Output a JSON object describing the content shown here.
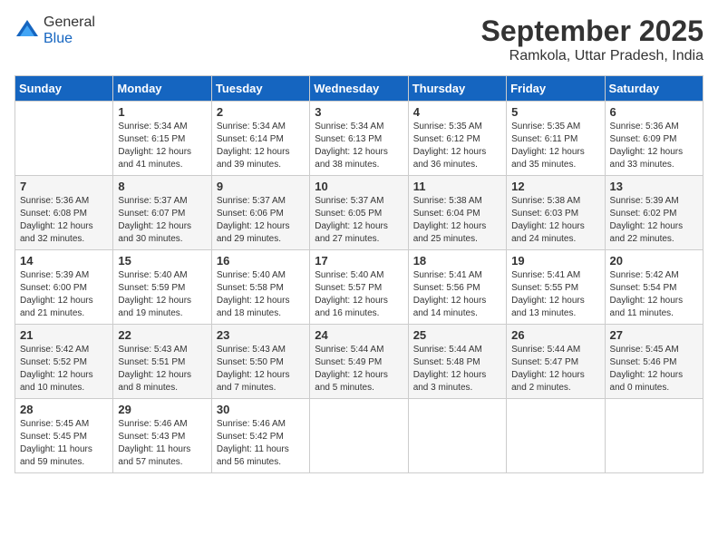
{
  "header": {
    "logo_general": "General",
    "logo_blue": "Blue",
    "month_title": "September 2025",
    "location": "Ramkola, Uttar Pradesh, India"
  },
  "weekdays": [
    "Sunday",
    "Monday",
    "Tuesday",
    "Wednesday",
    "Thursday",
    "Friday",
    "Saturday"
  ],
  "weeks": [
    [
      {
        "day": "",
        "sunrise": "",
        "sunset": "",
        "daylight": ""
      },
      {
        "day": "1",
        "sunrise": "Sunrise: 5:34 AM",
        "sunset": "Sunset: 6:15 PM",
        "daylight": "Daylight: 12 hours and 41 minutes."
      },
      {
        "day": "2",
        "sunrise": "Sunrise: 5:34 AM",
        "sunset": "Sunset: 6:14 PM",
        "daylight": "Daylight: 12 hours and 39 minutes."
      },
      {
        "day": "3",
        "sunrise": "Sunrise: 5:34 AM",
        "sunset": "Sunset: 6:13 PM",
        "daylight": "Daylight: 12 hours and 38 minutes."
      },
      {
        "day": "4",
        "sunrise": "Sunrise: 5:35 AM",
        "sunset": "Sunset: 6:12 PM",
        "daylight": "Daylight: 12 hours and 36 minutes."
      },
      {
        "day": "5",
        "sunrise": "Sunrise: 5:35 AM",
        "sunset": "Sunset: 6:11 PM",
        "daylight": "Daylight: 12 hours and 35 minutes."
      },
      {
        "day": "6",
        "sunrise": "Sunrise: 5:36 AM",
        "sunset": "Sunset: 6:09 PM",
        "daylight": "Daylight: 12 hours and 33 minutes."
      }
    ],
    [
      {
        "day": "7",
        "sunrise": "Sunrise: 5:36 AM",
        "sunset": "Sunset: 6:08 PM",
        "daylight": "Daylight: 12 hours and 32 minutes."
      },
      {
        "day": "8",
        "sunrise": "Sunrise: 5:37 AM",
        "sunset": "Sunset: 6:07 PM",
        "daylight": "Daylight: 12 hours and 30 minutes."
      },
      {
        "day": "9",
        "sunrise": "Sunrise: 5:37 AM",
        "sunset": "Sunset: 6:06 PM",
        "daylight": "Daylight: 12 hours and 29 minutes."
      },
      {
        "day": "10",
        "sunrise": "Sunrise: 5:37 AM",
        "sunset": "Sunset: 6:05 PM",
        "daylight": "Daylight: 12 hours and 27 minutes."
      },
      {
        "day": "11",
        "sunrise": "Sunrise: 5:38 AM",
        "sunset": "Sunset: 6:04 PM",
        "daylight": "Daylight: 12 hours and 25 minutes."
      },
      {
        "day": "12",
        "sunrise": "Sunrise: 5:38 AM",
        "sunset": "Sunset: 6:03 PM",
        "daylight": "Daylight: 12 hours and 24 minutes."
      },
      {
        "day": "13",
        "sunrise": "Sunrise: 5:39 AM",
        "sunset": "Sunset: 6:02 PM",
        "daylight": "Daylight: 12 hours and 22 minutes."
      }
    ],
    [
      {
        "day": "14",
        "sunrise": "Sunrise: 5:39 AM",
        "sunset": "Sunset: 6:00 PM",
        "daylight": "Daylight: 12 hours and 21 minutes."
      },
      {
        "day": "15",
        "sunrise": "Sunrise: 5:40 AM",
        "sunset": "Sunset: 5:59 PM",
        "daylight": "Daylight: 12 hours and 19 minutes."
      },
      {
        "day": "16",
        "sunrise": "Sunrise: 5:40 AM",
        "sunset": "Sunset: 5:58 PM",
        "daylight": "Daylight: 12 hours and 18 minutes."
      },
      {
        "day": "17",
        "sunrise": "Sunrise: 5:40 AM",
        "sunset": "Sunset: 5:57 PM",
        "daylight": "Daylight: 12 hours and 16 minutes."
      },
      {
        "day": "18",
        "sunrise": "Sunrise: 5:41 AM",
        "sunset": "Sunset: 5:56 PM",
        "daylight": "Daylight: 12 hours and 14 minutes."
      },
      {
        "day": "19",
        "sunrise": "Sunrise: 5:41 AM",
        "sunset": "Sunset: 5:55 PM",
        "daylight": "Daylight: 12 hours and 13 minutes."
      },
      {
        "day": "20",
        "sunrise": "Sunrise: 5:42 AM",
        "sunset": "Sunset: 5:54 PM",
        "daylight": "Daylight: 12 hours and 11 minutes."
      }
    ],
    [
      {
        "day": "21",
        "sunrise": "Sunrise: 5:42 AM",
        "sunset": "Sunset: 5:52 PM",
        "daylight": "Daylight: 12 hours and 10 minutes."
      },
      {
        "day": "22",
        "sunrise": "Sunrise: 5:43 AM",
        "sunset": "Sunset: 5:51 PM",
        "daylight": "Daylight: 12 hours and 8 minutes."
      },
      {
        "day": "23",
        "sunrise": "Sunrise: 5:43 AM",
        "sunset": "Sunset: 5:50 PM",
        "daylight": "Daylight: 12 hours and 7 minutes."
      },
      {
        "day": "24",
        "sunrise": "Sunrise: 5:44 AM",
        "sunset": "Sunset: 5:49 PM",
        "daylight": "Daylight: 12 hours and 5 minutes."
      },
      {
        "day": "25",
        "sunrise": "Sunrise: 5:44 AM",
        "sunset": "Sunset: 5:48 PM",
        "daylight": "Daylight: 12 hours and 3 minutes."
      },
      {
        "day": "26",
        "sunrise": "Sunrise: 5:44 AM",
        "sunset": "Sunset: 5:47 PM",
        "daylight": "Daylight: 12 hours and 2 minutes."
      },
      {
        "day": "27",
        "sunrise": "Sunrise: 5:45 AM",
        "sunset": "Sunset: 5:46 PM",
        "daylight": "Daylight: 12 hours and 0 minutes."
      }
    ],
    [
      {
        "day": "28",
        "sunrise": "Sunrise: 5:45 AM",
        "sunset": "Sunset: 5:45 PM",
        "daylight": "Daylight: 11 hours and 59 minutes."
      },
      {
        "day": "29",
        "sunrise": "Sunrise: 5:46 AM",
        "sunset": "Sunset: 5:43 PM",
        "daylight": "Daylight: 11 hours and 57 minutes."
      },
      {
        "day": "30",
        "sunrise": "Sunrise: 5:46 AM",
        "sunset": "Sunset: 5:42 PM",
        "daylight": "Daylight: 11 hours and 56 minutes."
      },
      {
        "day": "",
        "sunrise": "",
        "sunset": "",
        "daylight": ""
      },
      {
        "day": "",
        "sunrise": "",
        "sunset": "",
        "daylight": ""
      },
      {
        "day": "",
        "sunrise": "",
        "sunset": "",
        "daylight": ""
      },
      {
        "day": "",
        "sunrise": "",
        "sunset": "",
        "daylight": ""
      }
    ]
  ]
}
